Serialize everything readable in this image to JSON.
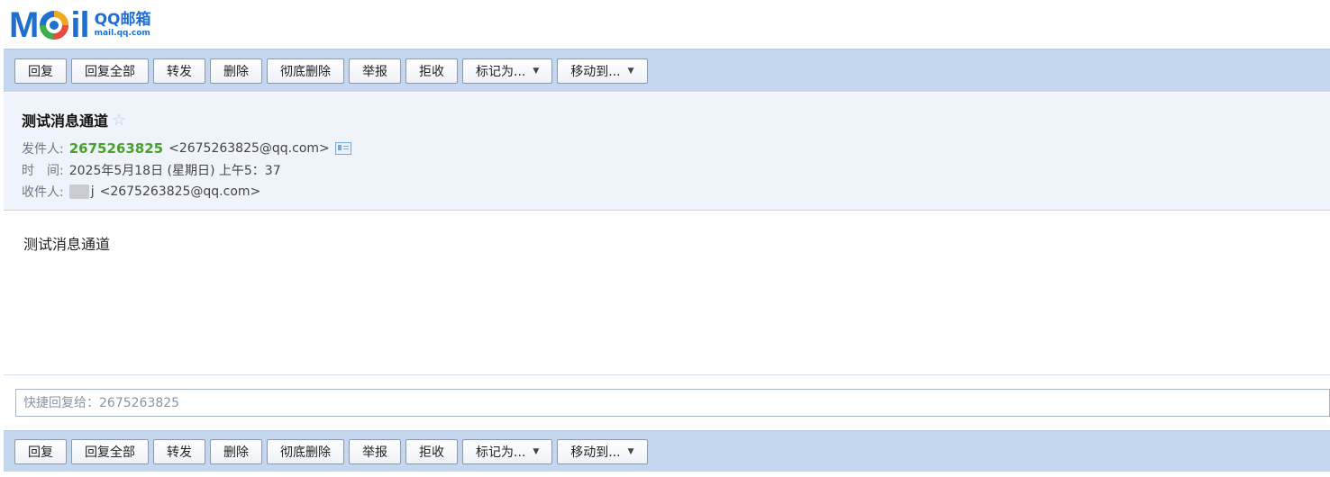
{
  "logo": {
    "wordmark_m": "M",
    "wordmark_il": "il",
    "product_cn": "QQ邮箱",
    "product_url": "mail.qq.com"
  },
  "toolbar": {
    "reply": "回复",
    "reply_all": "回复全部",
    "forward": "转发",
    "delete": "删除",
    "delete_permanently": "彻底删除",
    "report": "举报",
    "reject": "拒收",
    "mark_as": "标记为...",
    "move_to": "移动到..."
  },
  "mail": {
    "subject": "测试消息通道",
    "from_label": "发件人:",
    "from_name": "2675263825",
    "from_address": "<2675263825@qq.com>",
    "time_label": "时　间:",
    "time_value": "2025年5月18日 (星期日) 上午5：37",
    "to_label": "收件人:",
    "to_name_tail": "j",
    "to_address": "<2675263825@qq.com>",
    "body": "测试消息通道"
  },
  "quick_reply": {
    "placeholder": "快捷回复给：2675263825"
  },
  "colors": {
    "toolbar_bg": "#c4d7ee",
    "header_bg": "#eff4fa",
    "sender_green": "#4aa02c",
    "brand_blue": "#1e6fd0"
  },
  "icons": {
    "star": "star-outline-icon",
    "contact_card": "contact-card-icon",
    "dropdown": "caret-down-icon"
  }
}
